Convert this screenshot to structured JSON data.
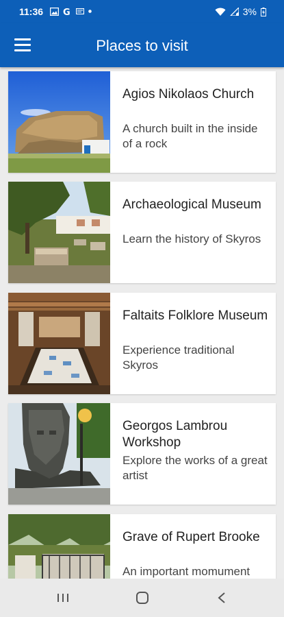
{
  "status": {
    "time": "11:36",
    "battery": "3%"
  },
  "header": {
    "title": "Places to visit",
    "menu_icon": "hamburger-menu-icon"
  },
  "places": [
    {
      "title": "Agios Nikolaos Church",
      "description": "A church built in the inside of a rock"
    },
    {
      "title": "Archaeological Museum",
      "description": "Learn the history of Skyros"
    },
    {
      "title": "Faltaits Folklore Museum",
      "description": "Experience traditional Skyros"
    },
    {
      "title": "Georgos Lambrou Workshop",
      "description": "Explore the works of a great artist"
    },
    {
      "title": "Grave of Rupert Brooke",
      "description": "An important momument"
    }
  ],
  "colors": {
    "primary": "#0d5fb8",
    "background": "#ececec",
    "card": "#ffffff"
  }
}
